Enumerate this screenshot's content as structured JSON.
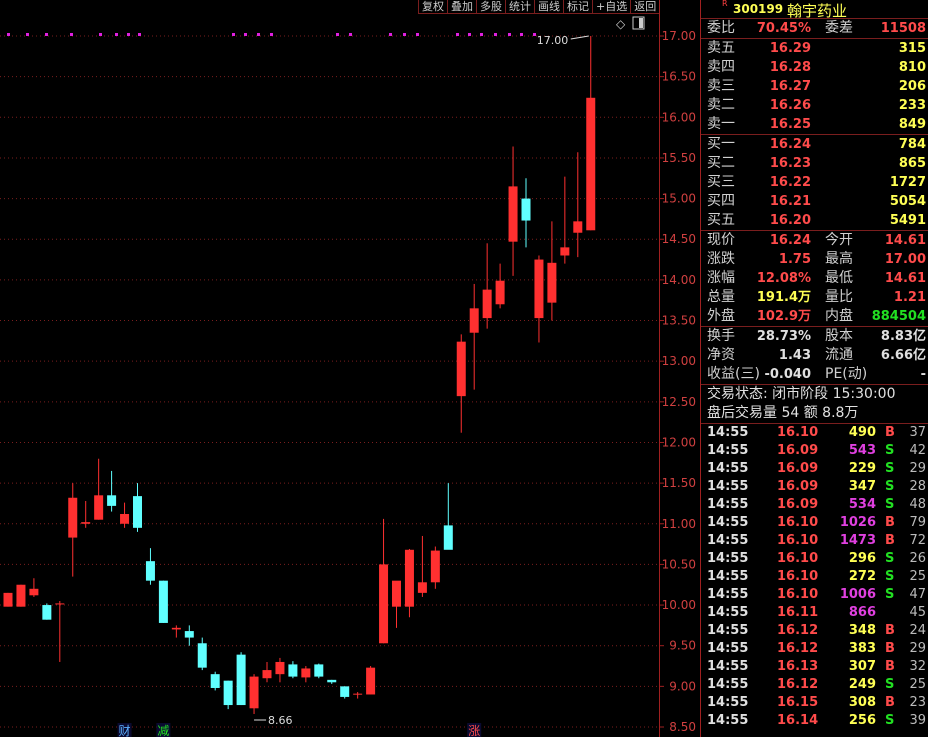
{
  "toolbar": [
    "复权",
    "叠加",
    "多股",
    "统计",
    "画线",
    "标记",
    "+自选",
    "返回"
  ],
  "stock": {
    "flag": "R",
    "code": "300199",
    "name": "翰宇药业"
  },
  "wei": {
    "label": "委比",
    "value": "70.45%",
    "label2": "委差",
    "value2": "11508"
  },
  "sells": [
    {
      "label": "卖五",
      "price": "16.29",
      "vol": "315"
    },
    {
      "label": "卖四",
      "price": "16.28",
      "vol": "810"
    },
    {
      "label": "卖三",
      "price": "16.27",
      "vol": "206"
    },
    {
      "label": "卖二",
      "price": "16.26",
      "vol": "233"
    },
    {
      "label": "卖一",
      "price": "16.25",
      "vol": "849"
    }
  ],
  "buys": [
    {
      "label": "买一",
      "price": "16.24",
      "vol": "784"
    },
    {
      "label": "买二",
      "price": "16.23",
      "vol": "865"
    },
    {
      "label": "买三",
      "price": "16.22",
      "vol": "1727"
    },
    {
      "label": "买四",
      "price": "16.21",
      "vol": "5054"
    },
    {
      "label": "买五",
      "price": "16.20",
      "vol": "5491"
    }
  ],
  "quote": [
    {
      "l1": "现价",
      "v1": "16.24",
      "c1": "red",
      "l2": "今开",
      "v2": "14.61",
      "c2": "red"
    },
    {
      "l1": "涨跌",
      "v1": "1.75",
      "c1": "red",
      "l2": "最高",
      "v2": "17.00",
      "c2": "red"
    },
    {
      "l1": "涨幅",
      "v1": "12.08%",
      "c1": "red",
      "l2": "最低",
      "v2": "14.61",
      "c2": "red"
    },
    {
      "l1": "总量",
      "v1": "191.4万",
      "c1": "yel",
      "l2": "量比",
      "v2": "1.21",
      "c2": "red"
    },
    {
      "l1": "外盘",
      "v1": "102.9万",
      "c1": "red",
      "l2": "内盘",
      "v2": "884504",
      "c2": "grn"
    }
  ],
  "finance": [
    {
      "l1": "换手",
      "v1": "28.73%",
      "l2": "股本",
      "v2": "8.83亿"
    },
    {
      "l1": "净资",
      "v1": "1.43",
      "l2": "流通",
      "v2": "6.66亿"
    },
    {
      "l1": "收益(三)",
      "v1": "-0.040",
      "l2": "PE(动)",
      "v2": "-"
    }
  ],
  "status": {
    "line1": "交易状态: 闭市阶段 15:30:00",
    "line2": "盘后交易量 54 额 8.8万"
  },
  "ticks": [
    {
      "time": "14:55",
      "price": "16.10",
      "vol": "490",
      "vc": "yel",
      "bs": "B",
      "n": "37"
    },
    {
      "time": "14:55",
      "price": "16.09",
      "vol": "543",
      "vc": "mag",
      "bs": "S",
      "n": "42"
    },
    {
      "time": "14:55",
      "price": "16.09",
      "vol": "229",
      "vc": "yel",
      "bs": "S",
      "n": "29"
    },
    {
      "time": "14:55",
      "price": "16.09",
      "vol": "347",
      "vc": "yel",
      "bs": "S",
      "n": "28"
    },
    {
      "time": "14:55",
      "price": "16.09",
      "vol": "534",
      "vc": "mag",
      "bs": "S",
      "n": "48"
    },
    {
      "time": "14:55",
      "price": "16.10",
      "vol": "1026",
      "vc": "mag",
      "bs": "B",
      "n": "79"
    },
    {
      "time": "14:55",
      "price": "16.10",
      "vol": "1473",
      "vc": "mag",
      "bs": "B",
      "n": "72"
    },
    {
      "time": "14:55",
      "price": "16.10",
      "vol": "296",
      "vc": "yel",
      "bs": "S",
      "n": "26"
    },
    {
      "time": "14:55",
      "price": "16.10",
      "vol": "272",
      "vc": "yel",
      "bs": "S",
      "n": "25"
    },
    {
      "time": "14:55",
      "price": "16.10",
      "vol": "1006",
      "vc": "mag",
      "bs": "S",
      "n": "47"
    },
    {
      "time": "14:55",
      "price": "16.11",
      "vol": "866",
      "vc": "mag",
      "bs": "",
      "n": "45"
    },
    {
      "time": "14:55",
      "price": "16.12",
      "vol": "348",
      "vc": "yel",
      "bs": "B",
      "n": "24"
    },
    {
      "time": "14:55",
      "price": "16.12",
      "vol": "383",
      "vc": "yel",
      "bs": "B",
      "n": "29"
    },
    {
      "time": "14:55",
      "price": "16.13",
      "vol": "307",
      "vc": "yel",
      "bs": "B",
      "n": "32"
    },
    {
      "time": "14:55",
      "price": "16.12",
      "vol": "249",
      "vc": "yel",
      "bs": "S",
      "n": "25"
    },
    {
      "time": "14:55",
      "price": "16.15",
      "vol": "308",
      "vc": "yel",
      "bs": "B",
      "n": "23"
    },
    {
      "time": "14:55",
      "price": "16.14",
      "vol": "256",
      "vc": "yel",
      "bs": "S",
      "n": "39"
    }
  ],
  "chart_data": {
    "type": "candlestick",
    "y_ticks": [
      "17.00",
      "16.50",
      "16.00",
      "15.50",
      "15.00",
      "14.50",
      "14.00",
      "13.50",
      "13.00",
      "12.50",
      "12.00",
      "11.50",
      "11.00",
      "10.50",
      "10.00",
      "9.50",
      "9.00",
      "8.50"
    ],
    "ylim": [
      8.5,
      17.0
    ],
    "high_label": "17.00",
    "low_label": "8.66",
    "markers": [
      {
        "text": "财",
        "color": "#5bb0ff",
        "index": 9
      },
      {
        "text": "减",
        "color": "#22e022",
        "index": 12
      },
      {
        "text": "涨",
        "color": "#ff4b4b",
        "index": 36
      }
    ],
    "candles": [
      {
        "o": 9.98,
        "h": 10.15,
        "l": 9.98,
        "c": 10.15
      },
      {
        "o": 9.98,
        "h": 10.25,
        "l": 9.98,
        "c": 10.25
      },
      {
        "o": 10.12,
        "h": 10.33,
        "l": 10.1,
        "c": 10.2
      },
      {
        "o": 10.0,
        "h": 10.02,
        "l": 9.82,
        "c": 9.82
      },
      {
        "o": 10.02,
        "h": 10.05,
        "l": 9.3,
        "c": 10.02
      },
      {
        "o": 10.83,
        "h": 11.5,
        "l": 10.35,
        "c": 11.32
      },
      {
        "o": 11.0,
        "h": 11.28,
        "l": 10.95,
        "c": 11.02
      },
      {
        "o": 11.05,
        "h": 11.8,
        "l": 11.05,
        "c": 11.35
      },
      {
        "o": 11.35,
        "h": 11.65,
        "l": 11.15,
        "c": 11.22
      },
      {
        "o": 11.0,
        "h": 11.26,
        "l": 10.95,
        "c": 11.12
      },
      {
        "o": 11.34,
        "h": 11.5,
        "l": 10.9,
        "c": 10.95
      },
      {
        "o": 10.54,
        "h": 10.7,
        "l": 10.25,
        "c": 10.3
      },
      {
        "o": 10.3,
        "h": 10.3,
        "l": 9.78,
        "c": 9.78
      },
      {
        "o": 9.7,
        "h": 9.75,
        "l": 9.6,
        "c": 9.72
      },
      {
        "o": 9.68,
        "h": 9.75,
        "l": 9.5,
        "c": 9.6
      },
      {
        "o": 9.53,
        "h": 9.6,
        "l": 9.2,
        "c": 9.23
      },
      {
        "o": 9.15,
        "h": 9.18,
        "l": 8.95,
        "c": 8.98
      },
      {
        "o": 9.07,
        "h": 9.07,
        "l": 8.72,
        "c": 8.77
      },
      {
        "o": 9.39,
        "h": 9.42,
        "l": 8.77,
        "c": 8.77
      },
      {
        "o": 8.73,
        "h": 9.15,
        "l": 8.66,
        "c": 9.12
      },
      {
        "o": 9.1,
        "h": 9.3,
        "l": 9.05,
        "c": 9.2
      },
      {
        "o": 9.15,
        "h": 9.35,
        "l": 9.05,
        "c": 9.3
      },
      {
        "o": 9.27,
        "h": 9.31,
        "l": 9.1,
        "c": 9.12
      },
      {
        "o": 9.11,
        "h": 9.25,
        "l": 9.05,
        "c": 9.22
      },
      {
        "o": 9.27,
        "h": 9.28,
        "l": 9.1,
        "c": 9.12
      },
      {
        "o": 9.08,
        "h": 9.08,
        "l": 9.03,
        "c": 9.05
      },
      {
        "o": 9.0,
        "h": 9.0,
        "l": 8.85,
        "c": 8.87
      },
      {
        "o": 8.91,
        "h": 8.93,
        "l": 8.85,
        "c": 8.91
      },
      {
        "o": 8.9,
        "h": 9.25,
        "l": 8.9,
        "c": 9.23
      },
      {
        "o": 9.53,
        "h": 11.06,
        "l": 9.53,
        "c": 10.5
      },
      {
        "o": 9.98,
        "h": 10.13,
        "l": 9.72,
        "c": 10.3
      },
      {
        "o": 9.98,
        "h": 10.69,
        "l": 9.85,
        "c": 10.68
      },
      {
        "o": 10.15,
        "h": 10.85,
        "l": 10.1,
        "c": 10.28
      },
      {
        "o": 10.28,
        "h": 10.72,
        "l": 10.2,
        "c": 10.67
      },
      {
        "o": 10.98,
        "h": 11.5,
        "l": 10.9,
        "c": 10.68
      },
      {
        "o": 12.57,
        "h": 13.33,
        "l": 12.12,
        "c": 13.24
      },
      {
        "o": 13.35,
        "h": 13.95,
        "l": 12.65,
        "c": 13.65
      },
      {
        "o": 13.53,
        "h": 14.45,
        "l": 13.4,
        "c": 13.88
      },
      {
        "o": 13.7,
        "h": 14.2,
        "l": 13.65,
        "c": 13.99
      },
      {
        "o": 14.47,
        "h": 15.64,
        "l": 14.05,
        "c": 15.15
      },
      {
        "o": 15.0,
        "h": 15.25,
        "l": 14.4,
        "c": 14.73
      },
      {
        "o": 13.53,
        "h": 14.3,
        "l": 13.23,
        "c": 14.25
      },
      {
        "o": 13.72,
        "h": 14.72,
        "l": 13.5,
        "c": 14.21
      },
      {
        "o": 14.3,
        "h": 15.27,
        "l": 14.2,
        "c": 14.4
      },
      {
        "o": 14.58,
        "h": 15.57,
        "l": 14.28,
        "c": 14.72
      },
      {
        "o": 14.61,
        "h": 17.0,
        "l": 14.61,
        "c": 16.24
      }
    ]
  }
}
